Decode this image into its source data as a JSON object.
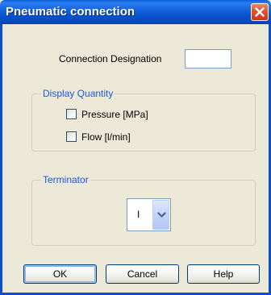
{
  "window": {
    "title": "Pneumatic connection",
    "close_icon": "close-icon"
  },
  "connection": {
    "label": "Connection Designation",
    "value": ""
  },
  "display_quantity": {
    "title": "Display Quantity",
    "options": [
      {
        "label": "Pressure [MPa]",
        "checked": false
      },
      {
        "label": "Flow [l/min]",
        "checked": false
      }
    ]
  },
  "terminator": {
    "title": "Terminator",
    "selected": "I",
    "dropdown_icon": "chevron-down-icon"
  },
  "buttons": {
    "ok": "OK",
    "cancel": "Cancel",
    "help": "Help"
  },
  "colors": {
    "titlebar": "#0b58d3",
    "group_title": "#1a5ad8",
    "dialog_bg": "#ece9d8",
    "close_button": "#e0522e"
  }
}
